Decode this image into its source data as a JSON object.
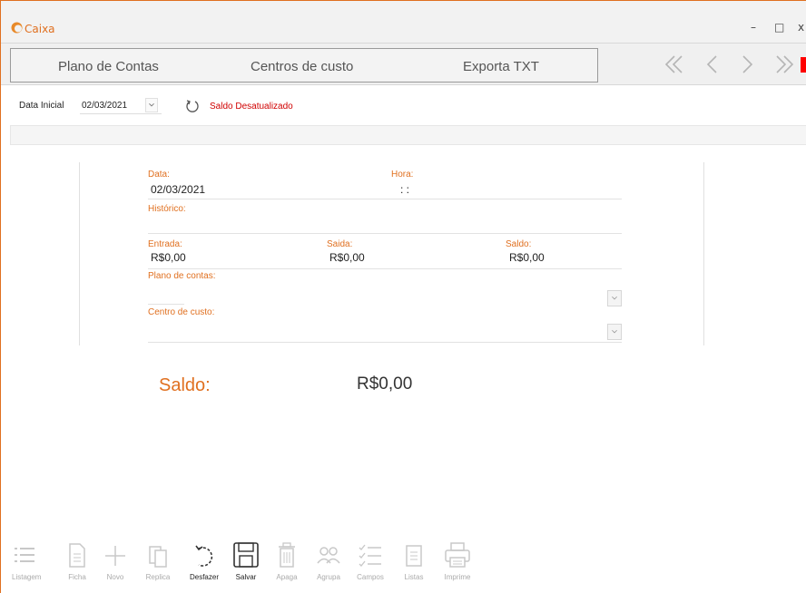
{
  "window": {
    "title": "Caixa",
    "minimize": "–",
    "maximize": "□",
    "close": "x"
  },
  "tabs": [
    "Plano de Contas",
    "Centros de custo",
    "Exporta TXT"
  ],
  "filter": {
    "date_label": "Data Inicial",
    "date_value": "02/03/2021",
    "status": "Saldo Desatualizado"
  },
  "form": {
    "data_label": "Data:",
    "data_value": "02/03/2021",
    "hora_label": "Hora:",
    "hora_value": ": :",
    "historico_label": "Histórico:",
    "entrada_label": "Entrada:",
    "entrada_value": "R$0,00",
    "saida_label": "Saida:",
    "saida_value": "R$0,00",
    "saldo_label": "Saldo:",
    "saldo_value": "R$0,00",
    "plano_label": "Plano de contas:",
    "centro_label": "Centro de custo:"
  },
  "summary": {
    "label": "Saldo:",
    "value": "R$0,00"
  },
  "toolbar": {
    "listagem": "Listagem",
    "ficha": "Ficha",
    "novo": "Novo",
    "replica": "Replica",
    "desfazer": "Desfazer",
    "salvar": "Salvar",
    "apaga": "Apaga",
    "agrupa": "Agrupa",
    "campos": "Campos",
    "listas": "Listas",
    "imprime": "Imprime"
  },
  "colors": {
    "accent": "#e07020",
    "status_red": "#d00000",
    "nav_red": "#ff0000"
  },
  "icons": [
    "caixa-logo-icon",
    "first-icon",
    "prev-icon",
    "next-icon",
    "last-icon",
    "refresh-icon",
    "chevron-down-icon",
    "list-icon",
    "doc-icon",
    "plus-icon",
    "copy-icon",
    "undo-icon",
    "save-icon",
    "trash-icon",
    "group-icon",
    "checklist-icon",
    "lists-icon",
    "printer-icon"
  ]
}
